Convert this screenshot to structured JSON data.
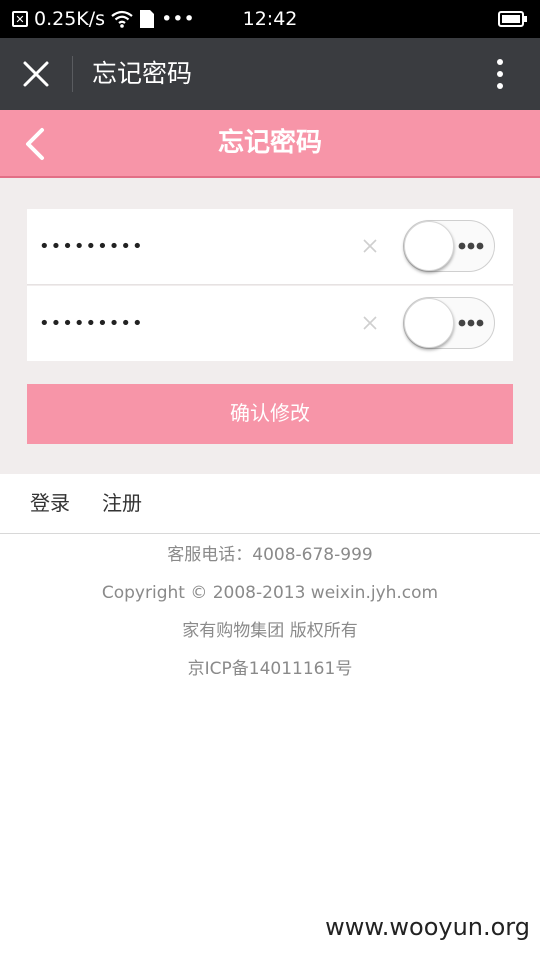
{
  "status_bar": {
    "network_speed": "0.25K/s",
    "time": "12:42",
    "more_indicator": "•••"
  },
  "app_bar": {
    "title": "忘记密码"
  },
  "page_header": {
    "title": "忘记密码"
  },
  "form": {
    "password_value": "•••••••••",
    "confirm_password_value": "•••••••••",
    "confirm_button_label": "确认修改"
  },
  "links": {
    "login_label": "登录",
    "register_label": "注册"
  },
  "footer": {
    "phone": "客服电话：4008-678-999",
    "copyright": "Copyright © 2008-2013 weixin.jyh.com",
    "company": "家有购物集团 版权所有",
    "icp": "京ICP备14011161号"
  },
  "watermark": "www.wooyun.org",
  "colors": {
    "accent_pink": "#f795a8",
    "app_bar": "#3a3c40",
    "form_background": "#f1eded"
  },
  "icons": [
    "notification-icon",
    "wifi-icon",
    "sim-icon",
    "battery-icon",
    "close-icon",
    "more-vertical-icon",
    "back-icon",
    "clear-icon",
    "toggle-switch"
  ]
}
